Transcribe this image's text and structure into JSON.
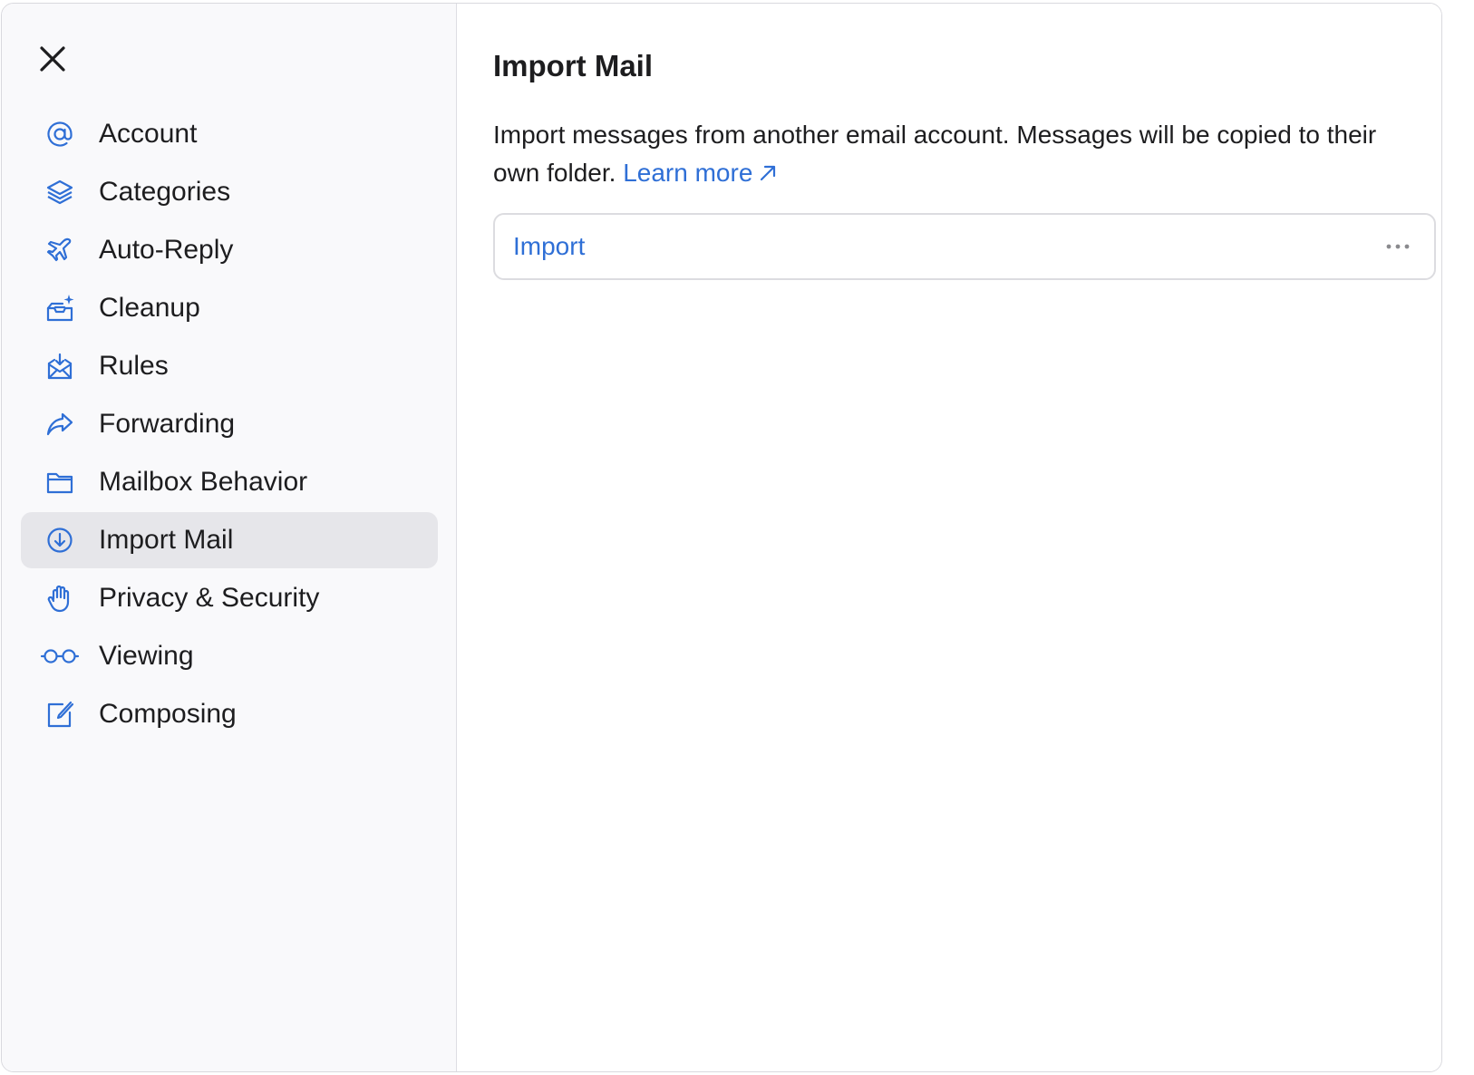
{
  "sidebar": {
    "close_icon": "close-icon",
    "items": [
      {
        "label": "Account",
        "icon": "at-icon",
        "active": false
      },
      {
        "label": "Categories",
        "icon": "layers-icon",
        "active": false
      },
      {
        "label": "Auto-Reply",
        "icon": "airplane-icon",
        "active": false
      },
      {
        "label": "Cleanup",
        "icon": "tray-sparkle-icon",
        "active": false
      },
      {
        "label": "Rules",
        "icon": "envelope-rules-icon",
        "active": false
      },
      {
        "label": "Forwarding",
        "icon": "forward-arrow-icon",
        "active": false
      },
      {
        "label": "Mailbox Behavior",
        "icon": "folder-icon",
        "active": false
      },
      {
        "label": "Import Mail",
        "icon": "download-circle-icon",
        "active": true
      },
      {
        "label": "Privacy & Security",
        "icon": "hand-icon",
        "active": false
      },
      {
        "label": "Viewing",
        "icon": "glasses-icon",
        "active": false
      },
      {
        "label": "Composing",
        "icon": "compose-icon",
        "active": false
      }
    ]
  },
  "main": {
    "title": "Import Mail",
    "description": "Import messages from another email account. Messages will be copied to their own folder.",
    "learn_more": "Learn more",
    "import_label": "Import",
    "more_icon": "more-horizontal-icon"
  },
  "colors": {
    "accent": "#2f6fd6",
    "text": "#1d1d1f",
    "sidebar_bg": "#f9f9fb",
    "active_bg": "#e6e6ea",
    "border": "#dcdce0"
  }
}
